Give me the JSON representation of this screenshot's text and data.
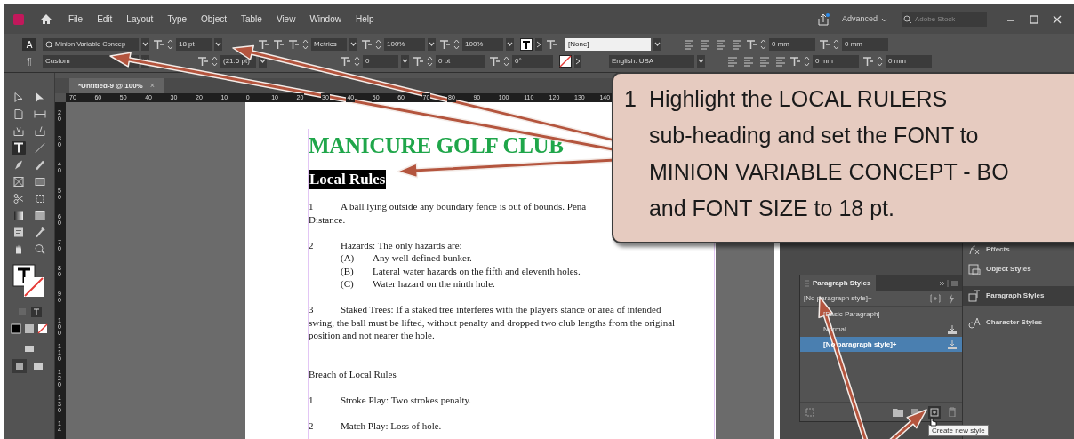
{
  "app_bar": {
    "menus": [
      "File",
      "Edit",
      "Layout",
      "Type",
      "Object",
      "Table",
      "View",
      "Window",
      "Help"
    ],
    "workspace": "Advanced",
    "search_placeholder": "Adobe Stock"
  },
  "control_panel": {
    "character_mode": {
      "label": "A",
      "selected": true
    },
    "paragraph_mode": {
      "label": "¶",
      "selected": false
    },
    "font_family": "Minion Variable Concep",
    "font_style": "Custom",
    "font_size": "18 pt",
    "leading": "(21.6 pt)",
    "kerning": "Metrics",
    "tracking": "0",
    "vertical_scale": "100%",
    "horizontal_scale": "100%",
    "baseline_shift": "0 pt",
    "skew": "0°",
    "paragraph_style": "[None]",
    "language": "English: USA",
    "indents": [
      "0 mm",
      "0 mm",
      "0 mm",
      "0 mm"
    ]
  },
  "tools": [
    {
      "selected": false
    },
    {
      "selected": false
    },
    {
      "selected": false
    },
    {
      "selected": false
    },
    {
      "selected": false
    },
    {
      "selected": false
    },
    {
      "selected": true
    },
    {
      "selected": false
    },
    {
      "selected": false
    },
    {
      "selected": false
    },
    {
      "selected": false
    },
    {
      "selected": false
    },
    {
      "selected": false
    },
    {
      "selected": false
    },
    {
      "selected": false
    },
    {
      "selected": false
    },
    {
      "selected": false
    },
    {
      "selected": false
    },
    {
      "selected": false
    },
    {
      "selected": false
    }
  ],
  "document_tab": {
    "title": "*Untitled-9 @ 100%",
    "close": "×"
  },
  "rulers": {
    "horizontal": [
      "70",
      "60",
      "50",
      "40",
      "30",
      "20",
      "10",
      "0",
      "10",
      "20",
      "30",
      "40",
      "50",
      "60",
      "70",
      "80",
      "90",
      "100",
      "110",
      "120",
      "130",
      "140"
    ],
    "vertical": [
      "20",
      "30",
      "40",
      "50",
      "60",
      "70",
      "80",
      "90",
      "100",
      "110",
      "120",
      "130",
      "14"
    ]
  },
  "document": {
    "title": "MANICURE GOLF CLUB",
    "subheading": {
      "text": "Local Rules",
      "selected": true
    },
    "blocks": [
      {
        "kind": "numbered",
        "number": "1",
        "lines": [
          "A ball lying outside any boundary fence is out of bounds.  Pena",
          "Distance."
        ]
      },
      {
        "kind": "numbered",
        "number": "2",
        "lines": [
          "Hazards:  The only hazards are:"
        ]
      },
      {
        "kind": "sub",
        "label": "(A)",
        "text": "Any well defined bunker."
      },
      {
        "kind": "sub",
        "label": "(B)",
        "text": "Lateral water hazards on the fifth and eleventh holes."
      },
      {
        "kind": "sub",
        "label": "(C)",
        "text": "Water hazard on the ninth hole."
      },
      {
        "kind": "numbered",
        "number": "3",
        "lines": [
          "Staked Trees:  If a staked tree interferes with the players stance or area of intended",
          "swing, the ball must be lifted, without penalty and dropped two club lengths from the original",
          "position and not nearer the hole."
        ]
      },
      {
        "kind": "heading",
        "text": "Breach of Local Rules"
      },
      {
        "kind": "numbered",
        "number": "1",
        "lines": [
          "Stroke Play:  Two strokes penalty."
        ]
      },
      {
        "kind": "numbered",
        "number": "2",
        "lines": [
          "Match Play:  Loss of hole."
        ]
      }
    ]
  },
  "paragraph_styles_panel": {
    "title": "Paragraph Styles",
    "current_style": "[No paragraph style]+",
    "styles": [
      {
        "name": "[Basic Paragraph]",
        "selected": false
      },
      {
        "name": "Normal",
        "selected": false
      },
      {
        "name": "[No paragraph style]+",
        "selected": true
      }
    ],
    "tooltip": "Create new style"
  },
  "side_panels": [
    {
      "label": "Effects",
      "selected": false
    },
    {
      "label": "Object Styles",
      "selected": false
    },
    {
      "label": "Paragraph Styles",
      "selected": true
    },
    {
      "label": "Character Styles",
      "selected": false
    }
  ],
  "callout": {
    "step": "1",
    "lines": [
      "Highlight the LOCAL RULERS",
      "sub-heading and set the FONT to",
      "MINION VARIABLE CONCEPT - BO",
      "and FONT SIZE to 18 pt."
    ]
  }
}
